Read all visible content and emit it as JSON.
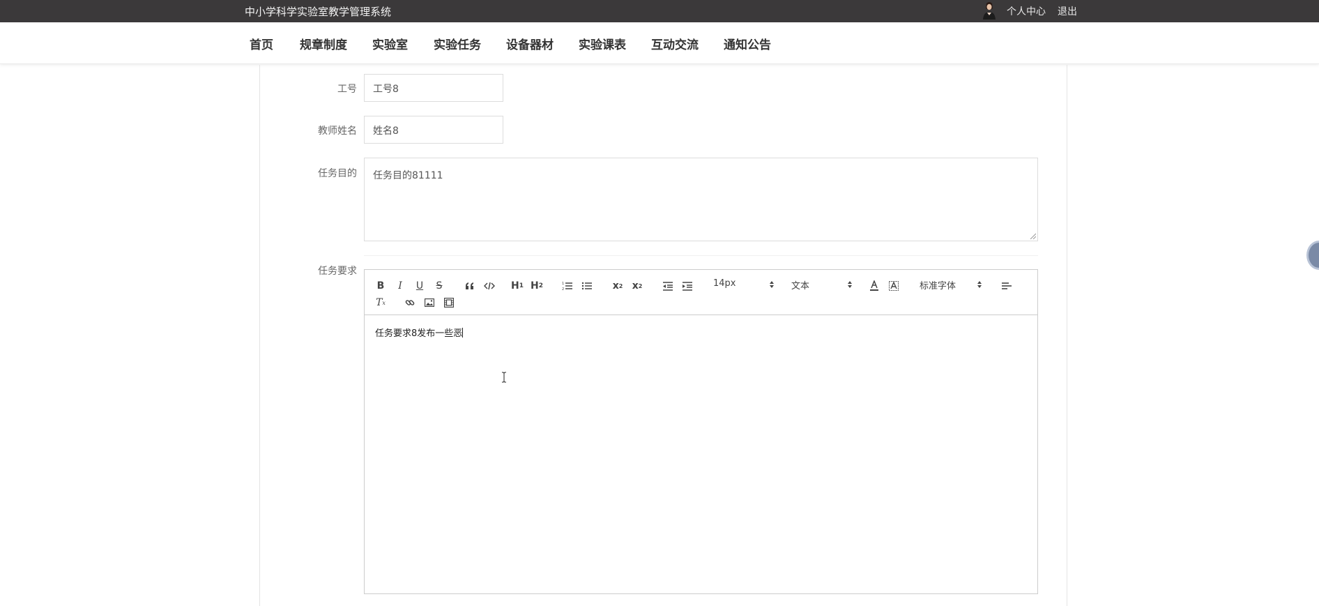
{
  "header": {
    "site_title": "中小学科学实验室教学管理系统",
    "profile_link": "个人中心",
    "logout_link": "退出"
  },
  "nav": {
    "items": [
      "首页",
      "规章制度",
      "实验室",
      "实验任务",
      "设备器材",
      "实验课表",
      "互动交流",
      "通知公告"
    ]
  },
  "form": {
    "job_no": {
      "label": "工号",
      "value": "工号8"
    },
    "teacher_name": {
      "label": "教师姓名",
      "value": "姓名8"
    },
    "task_purpose": {
      "label": "任务目的",
      "value": "任务目的81111"
    },
    "task_requirement": {
      "label": "任务要求",
      "editor": {
        "font_size": "14px",
        "block_format": "文本",
        "font_family": "标准字体",
        "content": "任务要求8发布一些恶"
      }
    }
  }
}
